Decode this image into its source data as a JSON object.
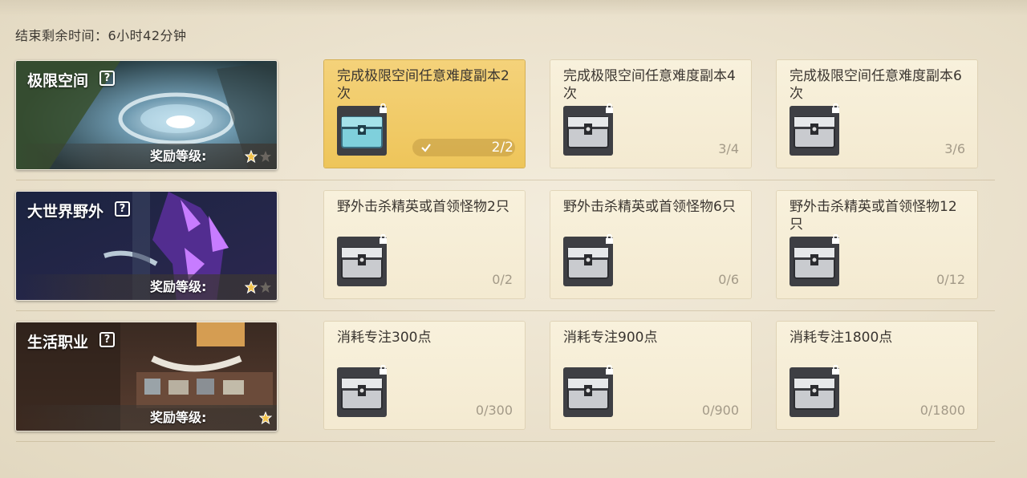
{
  "header": {
    "timer_label": "结束剩余时间：6小时42分钟"
  },
  "reward_level_label": "奖励等级:",
  "help_symbol": "?",
  "rows": [
    {
      "title": "极限空间",
      "stars_filled": 1,
      "stars_total": 2,
      "tasks": [
        {
          "text": "完成极限空间任意难度副本2次",
          "progress": "2/2",
          "completed": true,
          "chest": "blue-chest-icon"
        },
        {
          "text": "完成极限空间任意难度副本4次",
          "progress": "3/4",
          "completed": false,
          "chest": "silver-chest-icon"
        },
        {
          "text": "完成极限空间任意难度副本6次",
          "progress": "3/6",
          "completed": false,
          "chest": "silver-chest-icon"
        }
      ]
    },
    {
      "title": "大世界野外",
      "stars_filled": 1,
      "stars_total": 2,
      "tasks": [
        {
          "text": "野外击杀精英或首领怪物2只",
          "progress": "0/2",
          "completed": false,
          "chest": "silver-chest-icon"
        },
        {
          "text": "野外击杀精英或首领怪物6只",
          "progress": "0/6",
          "completed": false,
          "chest": "silver-chest-icon"
        },
        {
          "text": "野外击杀精英或首领怪物12只",
          "progress": "0/12",
          "completed": false,
          "chest": "silver-chest-icon"
        }
      ]
    },
    {
      "title": "生活职业",
      "stars_filled": 1,
      "stars_total": 1,
      "tasks": [
        {
          "text": "消耗专注300点",
          "progress": "0/300",
          "completed": false,
          "chest": "silver-chest-icon"
        },
        {
          "text": "消耗专注900点",
          "progress": "0/900",
          "completed": false,
          "chest": "silver-chest-icon"
        },
        {
          "text": "消耗专注1800点",
          "progress": "0/1800",
          "completed": false,
          "chest": "silver-chest-icon"
        }
      ]
    }
  ]
}
